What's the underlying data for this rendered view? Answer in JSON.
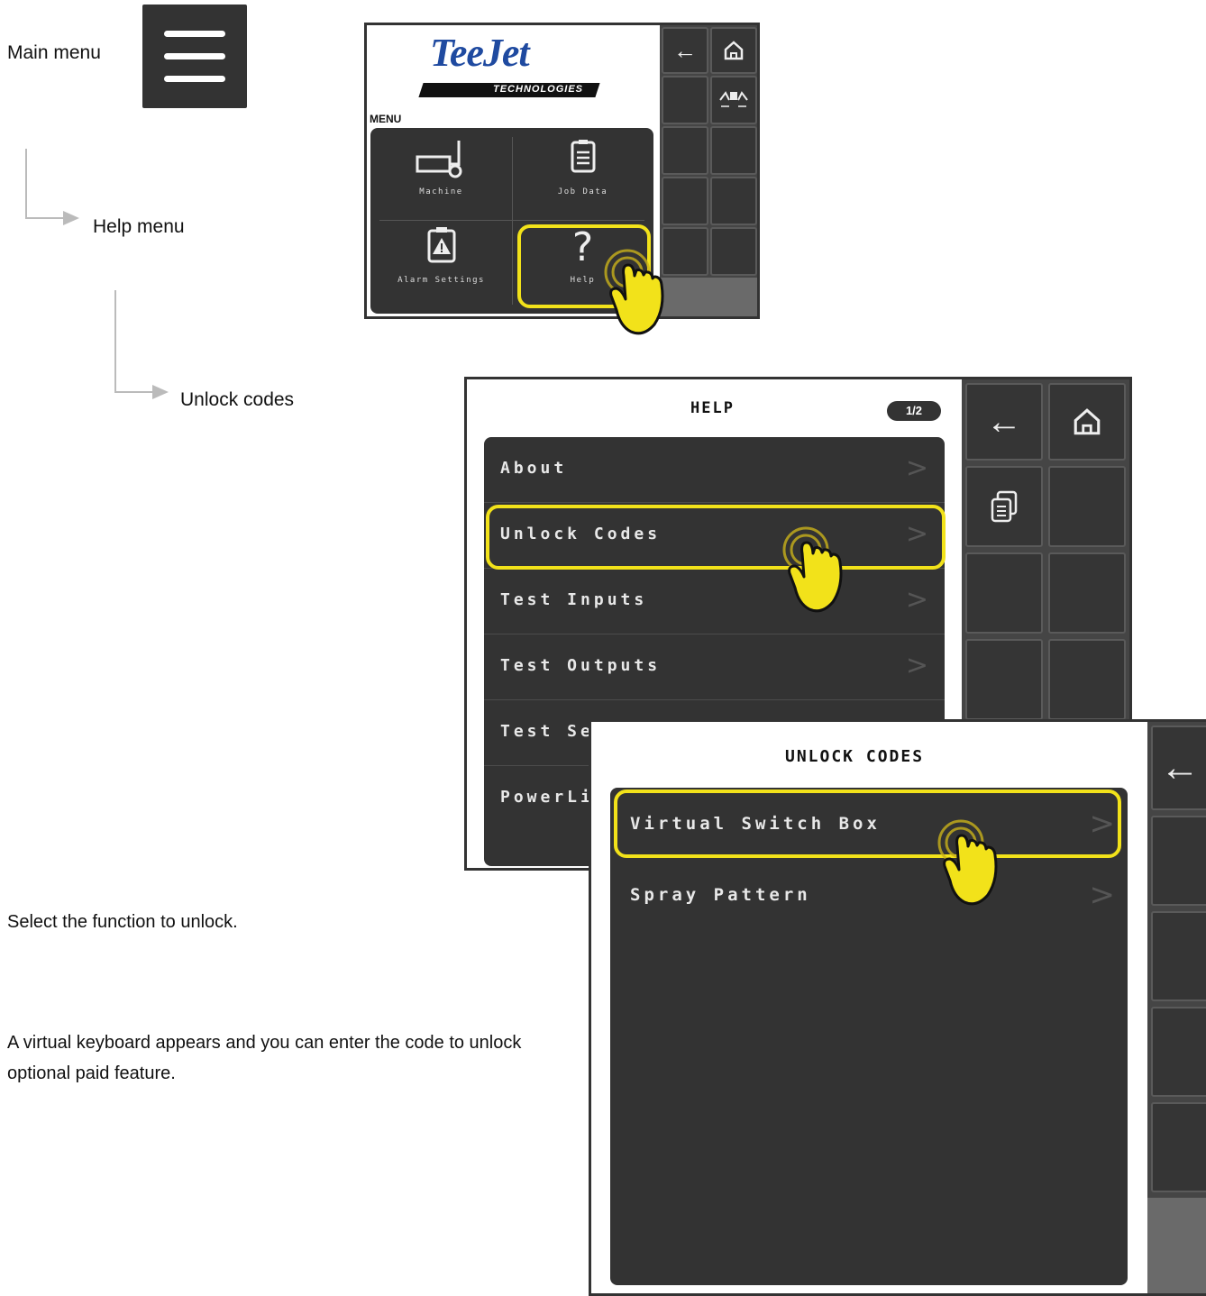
{
  "steps": {
    "main_menu": "Main menu",
    "help_menu": "Help menu",
    "unlock_codes": "Unlock codes"
  },
  "instructions": {
    "select": "Select the function to unlock.",
    "keyboard": "A virtual keyboard appears and you can enter the code to unlock optional paid feature."
  },
  "screen1": {
    "logo_main": "TeeJet",
    "logo_sub": "TECHNOLOGIES",
    "section": "MENU",
    "tiles": [
      "Machine",
      "Job Data",
      "Alarm Settings",
      "Help"
    ]
  },
  "screen2": {
    "title": "HELP",
    "page": "1/2",
    "items": [
      "About",
      "Unlock Codes",
      "Test Inputs",
      "Test Outputs",
      "Test Se",
      "PowerLi"
    ]
  },
  "screen3": {
    "title": "UNLOCK CODES",
    "items": [
      "Virtual Switch Box",
      "Spray Pattern"
    ]
  },
  "colors": {
    "highlight": "#f2e21a",
    "panel": "#333333",
    "sidebar": "#454545"
  },
  "icons": [
    "hamburger-icon",
    "back-arrow-icon",
    "home-icon",
    "boom-icon",
    "machine-icon",
    "job-data-icon",
    "alarm-icon",
    "help-icon",
    "copy-icon",
    "pointer-hand-icon",
    "chevron-right-icon"
  ]
}
